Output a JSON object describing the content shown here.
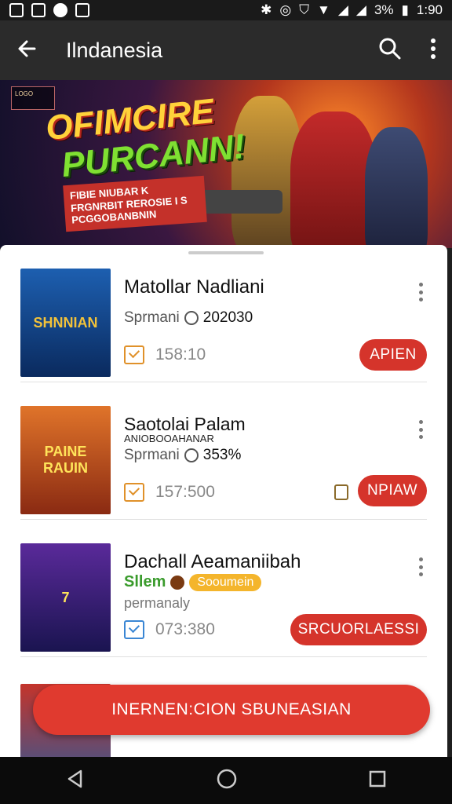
{
  "status_bar": {
    "battery": "3%",
    "time": "1:90"
  },
  "app_bar": {
    "title": "Ilndanesia"
  },
  "banner": {
    "headline_line1": "OFIMCIRE",
    "headline_line2": "PURCANN!",
    "subtitle": "FIBIE NIUBAR K FRGNRBIT REROSIE I S PCGGOBANBNIN"
  },
  "cards": [
    {
      "title": "Matollar Nadliani",
      "meta_label": "Sprmani",
      "meta_value": "202030",
      "time": "158:10",
      "action": "APIEN",
      "thumb_text": "SHNNIAN"
    },
    {
      "title": "Saotolai Palam",
      "subtitle": "ANIOBOOAHANAR",
      "meta_label": "Sprmani",
      "meta_value": "353%",
      "time": "157:500",
      "action": "NPIAW",
      "thumb_text": "PAINE RAUIN"
    },
    {
      "title": "Dachall Aeamaniibah",
      "tag_green": "Sllem",
      "tag_pill": "Sooumein",
      "description": "permanaly",
      "time": "073:380",
      "action": "SRCUORLAESSI",
      "thumb_text": "7"
    }
  ],
  "cta_button": "INERNEN:CION SBUNEASIAN"
}
